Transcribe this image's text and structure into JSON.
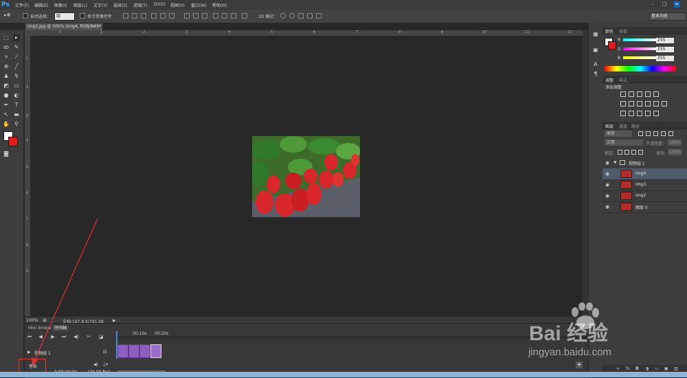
{
  "app": {
    "logo": "Ps"
  },
  "menu": [
    "文件(F)",
    "编辑(E)",
    "图像(I)",
    "图层(L)",
    "文字(Y)",
    "选择(S)",
    "滤镜(T)",
    "3D(D)",
    "视图(V)",
    "窗口(W)",
    "帮助(H)"
  ],
  "options_bar": {
    "auto_select_label": "自动选择：",
    "auto_select_value": "组",
    "show_transform_label": "显示变换控件",
    "mode_3d_label": "3D 模式：",
    "workspace": "基本功能"
  },
  "document": {
    "tab_title": "img1.jpg @ 100% (img4, RGB/8#) *",
    "close": "×"
  },
  "ruler": {
    "top_ticks": [
      "0",
      "1",
      "2",
      "3",
      "4",
      "5",
      "6",
      "7",
      "8",
      "9",
      "10",
      "11",
      "12"
    ],
    "left_ticks": [
      "1",
      "2",
      "3",
      "4",
      "5",
      "6",
      "7",
      "8",
      "9"
    ]
  },
  "status": {
    "zoom": "100%",
    "doc_size": "文档:197.8 K/791.0K"
  },
  "timeline": {
    "tabs": [
      "Mini Bridge",
      "时间轴"
    ],
    "time_marks": [
      "00:10s",
      "00:20s"
    ],
    "group_label": "视频组 1",
    "audio_label": "音轨",
    "timecode": "0:00:00:00",
    "fps": "(30.00 fps)"
  },
  "color_panel": {
    "tabs": [
      "颜色",
      "色板"
    ],
    "channels": [
      {
        "label": "R",
        "value": "255"
      },
      {
        "label": "G",
        "value": "255"
      },
      {
        "label": "B",
        "value": "255"
      }
    ]
  },
  "adjustments_panel": {
    "tabs": [
      "调整",
      "样式"
    ],
    "title": "添加调整"
  },
  "layers_panel": {
    "tabs": [
      "图层",
      "通道",
      "路径"
    ],
    "filter_label": "类型",
    "blend_mode": "正常",
    "opacity_label": "不透明度：",
    "opacity_value": "100%",
    "lock_label": "锁定：",
    "fill_label": "填充：",
    "fill_value": "100%",
    "layers": [
      {
        "name": "视频组 1",
        "type": "group"
      },
      {
        "name": "img4",
        "type": "layer",
        "active": true
      },
      {
        "name": "img3",
        "type": "layer"
      },
      {
        "name": "img2",
        "type": "layer"
      },
      {
        "name": "图层 0",
        "type": "layer"
      }
    ]
  },
  "watermark": {
    "main": "Bai 经验",
    "sub": "jingyan.baidu.com"
  },
  "colors": {
    "accent": "#4fa8ff",
    "clip": "#8c5fbf",
    "annotation": "#e23232"
  }
}
